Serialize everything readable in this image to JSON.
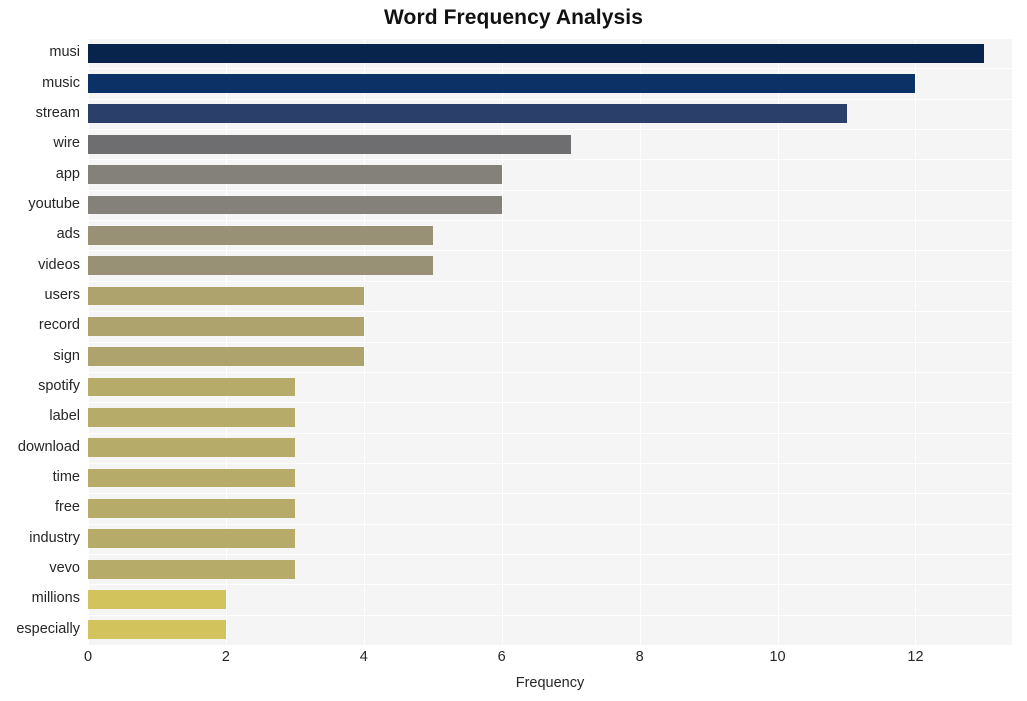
{
  "chart_data": {
    "type": "bar",
    "orientation": "horizontal",
    "title": "Word Frequency Analysis",
    "xlabel": "Frequency",
    "ylabel": "",
    "xlim": [
      0,
      13.4
    ],
    "ylim_categories": 20,
    "xticks": [
      0,
      2,
      4,
      6,
      8,
      10,
      12
    ],
    "xticklabels": [
      "0",
      "2",
      "4",
      "6",
      "8",
      "10",
      "12"
    ],
    "grid": true,
    "grid_color": "#ffffff",
    "plot_background": "#f5f5f5",
    "figure_background": "#ffffff",
    "legend": null,
    "categories": [
      "musi",
      "music",
      "stream",
      "wire",
      "app",
      "youtube",
      "ads",
      "videos",
      "users",
      "record",
      "sign",
      "spotify",
      "label",
      "download",
      "time",
      "free",
      "industry",
      "vevo",
      "millions",
      "especially"
    ],
    "values": [
      13,
      12,
      11,
      7,
      6,
      6,
      5,
      5,
      4,
      4,
      4,
      3,
      3,
      3,
      3,
      3,
      3,
      3,
      2,
      2
    ],
    "bar_colors": [
      "#08244c",
      "#0b3167",
      "#2b3f6b",
      "#6e6e70",
      "#83817a",
      "#838179",
      "#989176",
      "#989176",
      "#aea36c",
      "#aea36c",
      "#aea36c",
      "#b6ab68",
      "#b6ab68",
      "#b6ab68",
      "#b6ab68",
      "#b6ab68",
      "#b6ab68",
      "#b6ab68",
      "#d2c35c",
      "#d2c35c"
    ]
  }
}
